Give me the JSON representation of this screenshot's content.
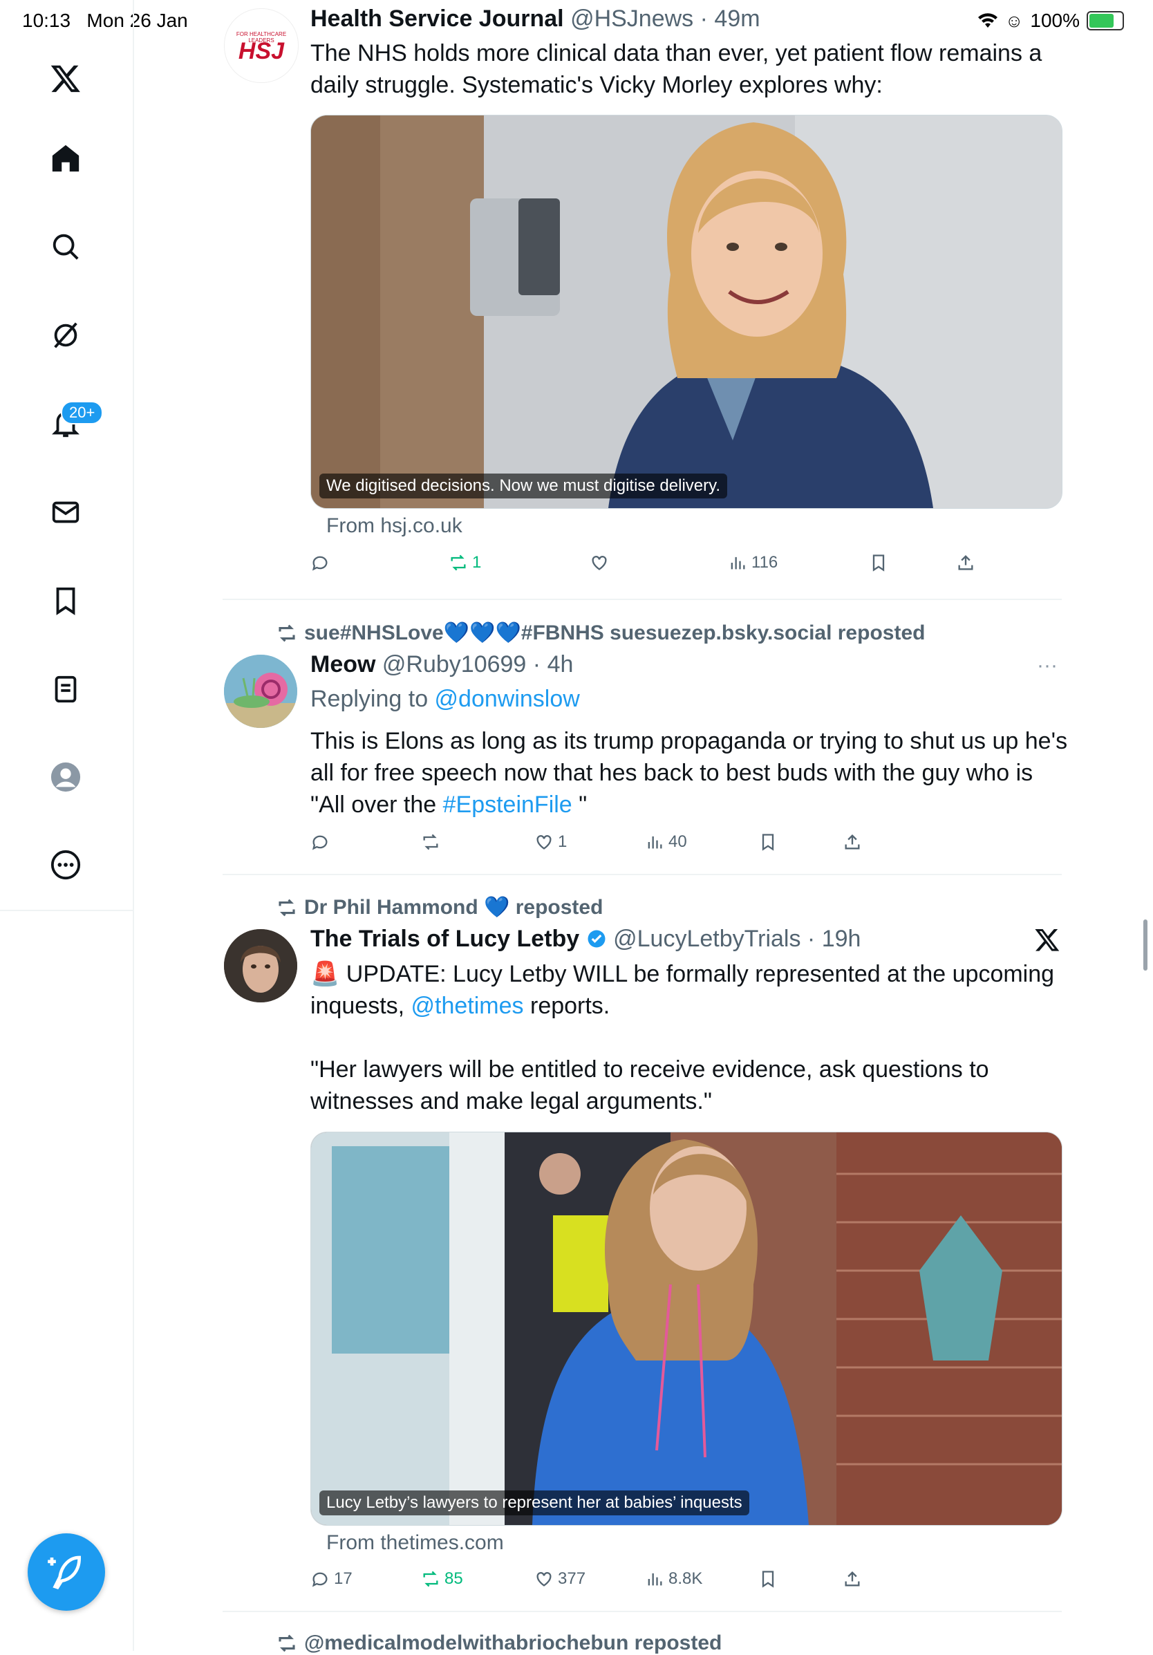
{
  "status_bar": {
    "time": "10:13",
    "date": "Mon 26 Jan",
    "battery": "100%"
  },
  "sidebar": {
    "items": [
      {
        "icon": "x-logo-icon"
      },
      {
        "icon": "home-icon"
      },
      {
        "icon": "search-icon"
      },
      {
        "icon": "grok-icon"
      },
      {
        "icon": "notifications-icon"
      },
      {
        "icon": "messages-icon"
      },
      {
        "icon": "bookmarks-icon"
      },
      {
        "icon": "lists-icon"
      },
      {
        "icon": "profile-icon"
      },
      {
        "icon": "more-icon"
      }
    ],
    "notifications_badge": "20+",
    "compose_icon": "compose-icon"
  },
  "feed": {
    "tweet1": {
      "name": "Health Service Journal",
      "handle": "@HSJnews",
      "time": "· 49m",
      "avatar_text": "HSJ",
      "avatar_small": "FOR HEALTHCARE LEADERS",
      "text": "The NHS holds more clinical data than ever, yet patient flow remains a daily struggle. Systematic's Vicky Morley explores why:",
      "card_caption": "We digitised decisions. Now we must digitise delivery.",
      "card_source": "From hsj.co.uk",
      "replies": "",
      "reposts": "1",
      "likes": "",
      "views": "116"
    },
    "tweet2": {
      "reposted_by": "sue#NHSLove💙💙💙#FBNHS suesuezep.bsky.social reposted",
      "name": "Meow",
      "handle": "@Ruby10699",
      "time": "· 4h",
      "replying_prefix": "Replying to ",
      "replying_to": "@donwinslow",
      "text_a": "This is Elons as long as its trump propaganda or trying to shut us up he's all for free speech now that hes back to best buds with the guy who is \"All over the ",
      "hashtag": "#EpsteinFile",
      "text_b": " \"",
      "replies": "",
      "reposts": "",
      "likes": "1",
      "views": "40"
    },
    "tweet3": {
      "reposted_by": "Dr Phil Hammond 💙 reposted",
      "name": "The Trials of Lucy Letby",
      "handle": "@LucyLetbyTrials",
      "time": "· 19h",
      "text_a": "🚨 UPDATE: Lucy Letby WILL be formally represented at the upcoming inquests, ",
      "mention": "@thetimes",
      "text_b": " reports.",
      "text_c": "\"Her lawyers will be entitled to receive evidence, ask questions to witnesses and make legal arguments.\"",
      "card_caption": "Lucy Letby’s lawyers to represent her at babies’ inquests",
      "card_source": "From thetimes.com",
      "replies": "17",
      "reposts": "85",
      "likes": "377",
      "views": "8.8K"
    },
    "tweet4": {
      "reposted_by": "@medicalmodelwithabriochebun reposted"
    }
  },
  "colors": {
    "accent": "#1d9bf0",
    "repost_green": "#00ba7c",
    "muted": "#536471"
  }
}
